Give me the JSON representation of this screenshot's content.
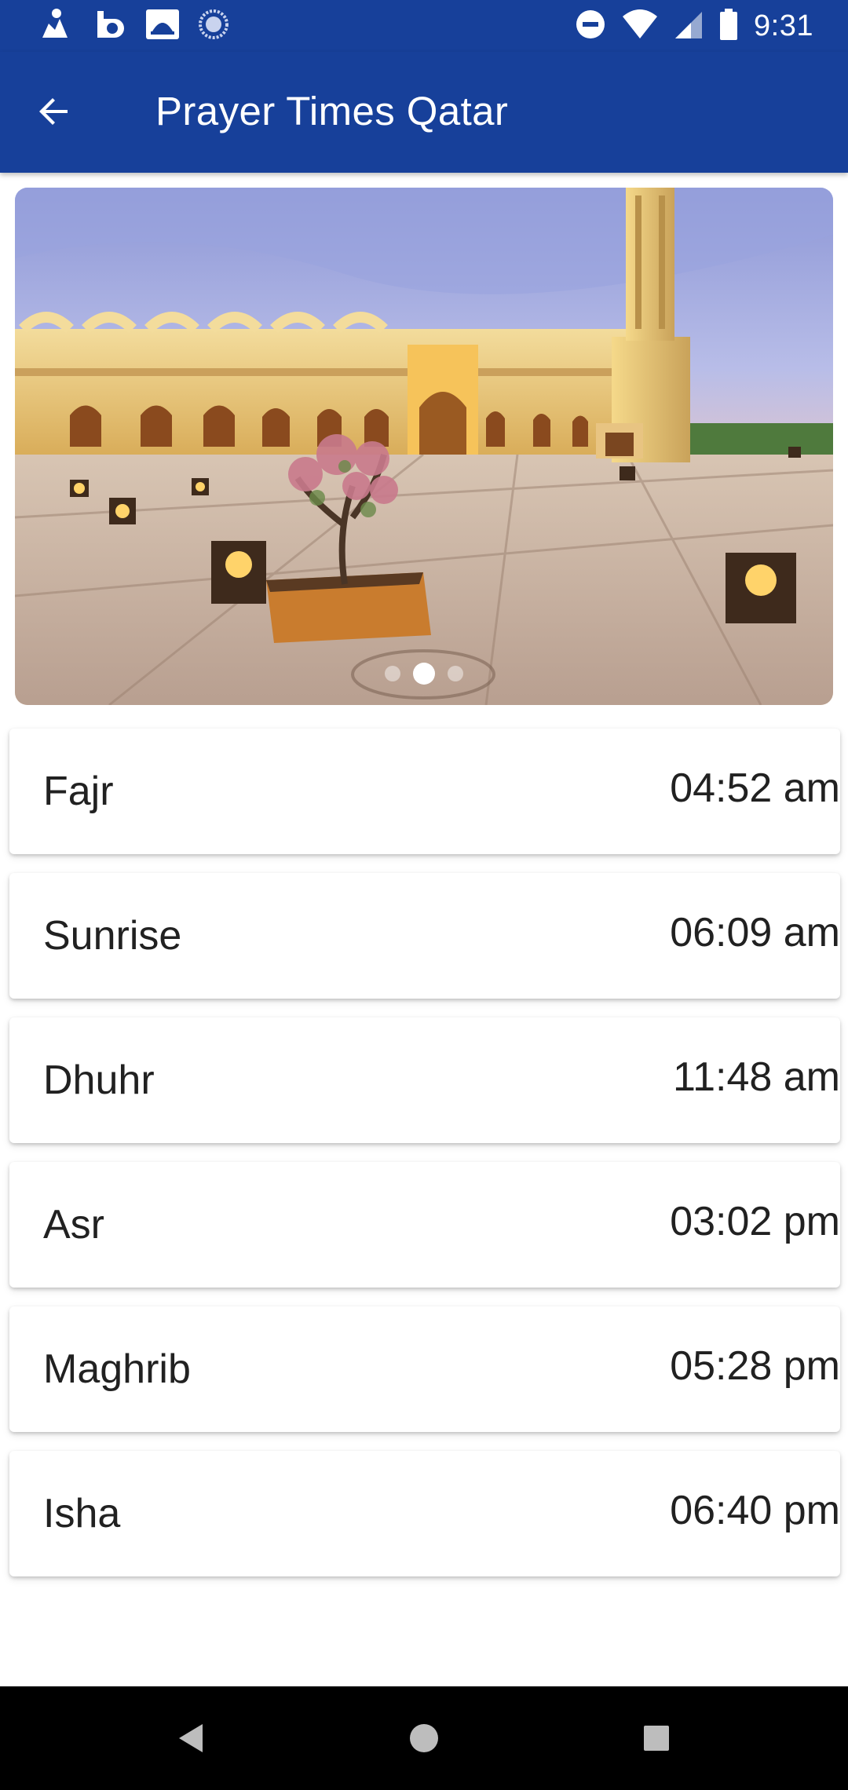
{
  "status_bar": {
    "time": "9:31",
    "left_icons": [
      "notification-icon-1",
      "notification-icon-2",
      "mosque-app-icon",
      "sync-icon"
    ],
    "right_icons": [
      "do-not-disturb-icon",
      "wifi-icon",
      "cellular-signal-icon",
      "battery-icon"
    ]
  },
  "app_bar": {
    "title": "Prayer Times Qatar",
    "back_icon": "arrow-left-icon",
    "color": "#17409a"
  },
  "carousel": {
    "page_count": 3,
    "active_index": 1
  },
  "prayers": [
    {
      "name": "Fajr",
      "time": "04:52 am"
    },
    {
      "name": "Sunrise",
      "time": "06:09 am"
    },
    {
      "name": "Dhuhr",
      "time": "11:48 am"
    },
    {
      "name": "Asr",
      "time": "03:02 pm"
    },
    {
      "name": "Maghrib",
      "time": "05:28 pm"
    },
    {
      "name": "Isha",
      "time": "06:40 pm"
    }
  ],
  "nav_bar": {
    "buttons": [
      "back-triangle-icon",
      "home-circle-icon",
      "recents-square-icon"
    ]
  }
}
